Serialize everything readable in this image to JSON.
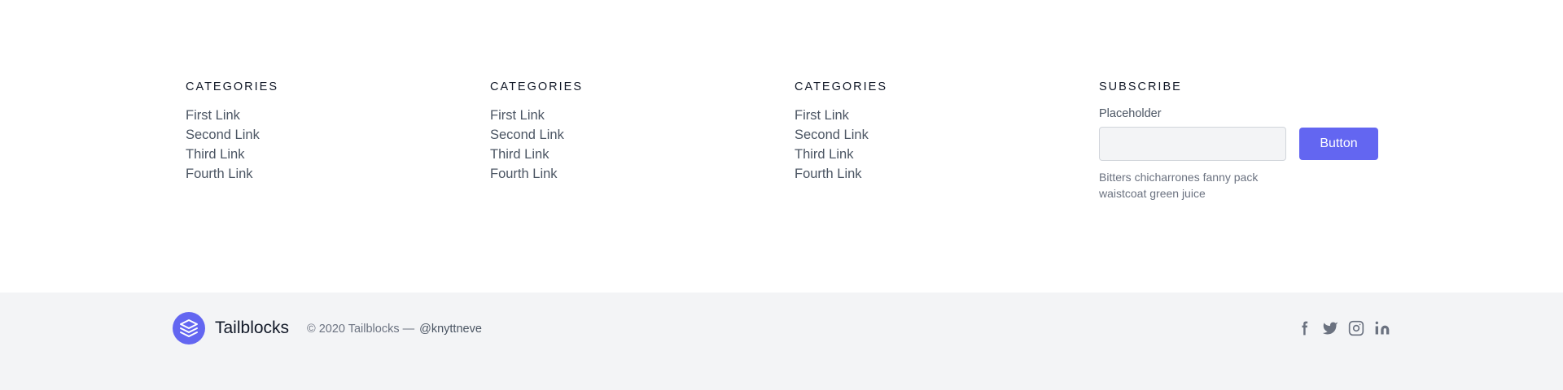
{
  "columns": [
    {
      "heading": "CATEGORIES",
      "links": [
        "First Link",
        "Second Link",
        "Third Link",
        "Fourth Link"
      ]
    },
    {
      "heading": "CATEGORIES",
      "links": [
        "First Link",
        "Second Link",
        "Third Link",
        "Fourth Link"
      ]
    },
    {
      "heading": "CATEGORIES",
      "links": [
        "First Link",
        "Second Link",
        "Third Link",
        "Fourth Link"
      ]
    }
  ],
  "subscribe": {
    "heading": "SUBSCRIBE",
    "label": "Placeholder",
    "input_value": "",
    "button_label": "Button",
    "description": "Bitters chicharrones fanny pack waistcoat green juice"
  },
  "footer": {
    "brand_name": "Tailblocks",
    "copyright": "© 2020 Tailblocks —",
    "handle": "@knyttneve",
    "socials": [
      "facebook-icon",
      "twitter-icon",
      "instagram-icon",
      "linkedin-icon"
    ]
  },
  "colors": {
    "accent": "#6366f1",
    "footer_bg": "#f3f4f6",
    "heading": "#111827",
    "text": "#4b5563"
  }
}
